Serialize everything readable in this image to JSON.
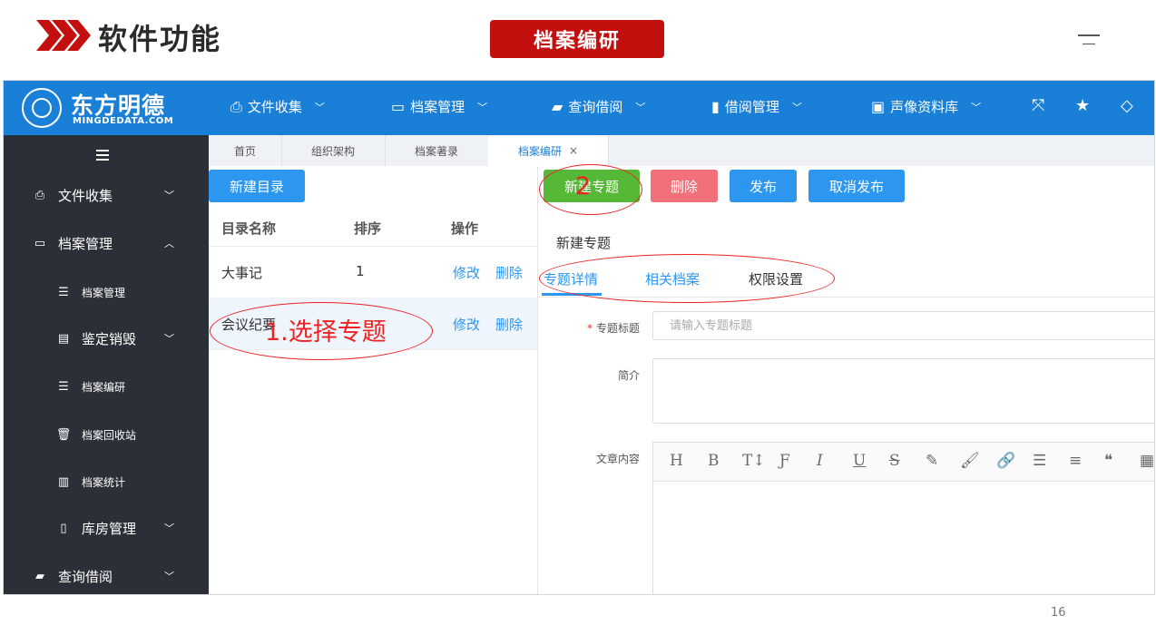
{
  "slide": {
    "title": "软件功能",
    "badge": "档案编研",
    "page_number": "16"
  },
  "app": {
    "logo": {
      "name": "东方明德",
      "sub": "MINGDEDATA.COM"
    },
    "top_nav": [
      {
        "label": "文件收集"
      },
      {
        "label": "档案管理"
      },
      {
        "label": "查询借阅"
      },
      {
        "label": "借阅管理"
      },
      {
        "label": "声像资料库"
      }
    ],
    "sidebar": [
      {
        "label": "文件收集"
      },
      {
        "label": "档案管理"
      },
      {
        "label": "档案管理"
      },
      {
        "label": "鉴定销毁"
      },
      {
        "label": "档案编研"
      },
      {
        "label": "档案回收站"
      },
      {
        "label": "档案统计"
      },
      {
        "label": "库房管理"
      },
      {
        "label": "查询借阅"
      }
    ],
    "tabs": [
      {
        "label": "首页"
      },
      {
        "label": "组织架构"
      },
      {
        "label": "档案著录"
      },
      {
        "label": "档案编研",
        "close": "×"
      }
    ],
    "left_panel": {
      "new_catalog": "新建目录",
      "columns": [
        "目录名称",
        "排序",
        "操作"
      ],
      "rows": [
        {
          "name": "大事记",
          "order": "1",
          "edit": "修改",
          "delete": "删除"
        },
        {
          "name": "会议纪要",
          "order": "",
          "edit": "修改",
          "delete": "删除"
        }
      ]
    },
    "right_panel": {
      "buttons": {
        "new_topic": "新建专题",
        "delete": "删除",
        "publish": "发布",
        "unpublish": "取消发布"
      },
      "subtitle": "新建专题",
      "tabs": [
        "专题详情",
        "相关档案",
        "权限设置"
      ],
      "form": {
        "required_mark": "*",
        "title_label": "专题标题",
        "title_placeholder": "请输入专题标题",
        "intro_label": "简介",
        "content_label": "文章内容"
      },
      "toolbar": [
        "H",
        "B",
        "T↕",
        "Ƒ",
        "I",
        "U",
        "S",
        "✎",
        "🖌",
        "🔗",
        "☰",
        "≡",
        "❝",
        "▦"
      ]
    }
  },
  "annotations": {
    "step1": "1.选择专题",
    "step2": "2"
  }
}
